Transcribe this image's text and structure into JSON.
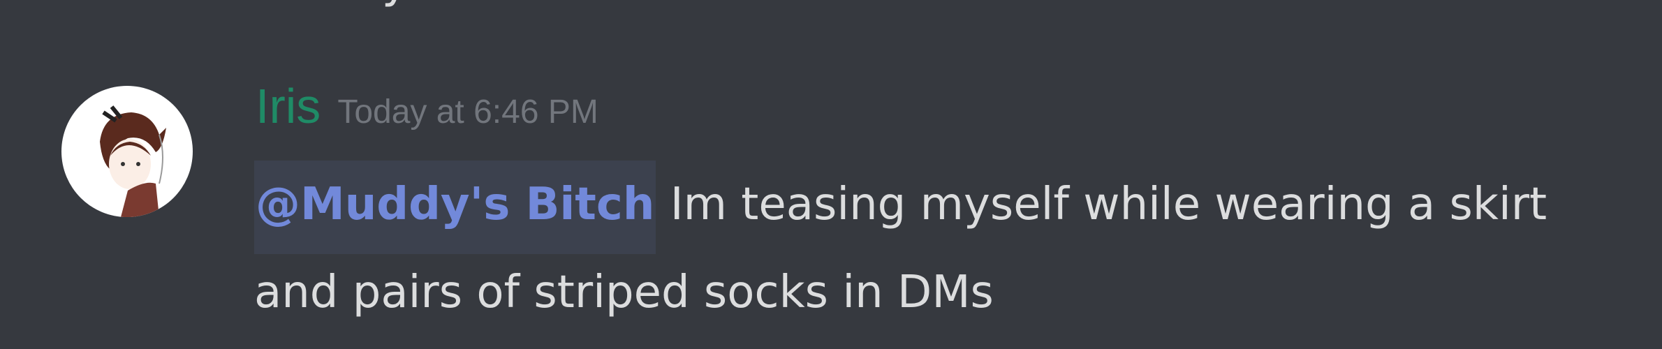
{
  "previous_message": {
    "text": "Muddy's Bitch."
  },
  "message": {
    "author": "Iris",
    "author_color": "#1f8b66",
    "timestamp": "Today at 6:46 PM",
    "mention": "@Muddy's Bitch",
    "mention_color": "#7289da",
    "text": " Im teasing myself while wearing a skirt and pairs of striped socks in DMs",
    "avatar_icon": "anime-girl-avatar"
  },
  "colors": {
    "background": "#36393f",
    "text": "#dcddde",
    "timestamp": "#72767d"
  }
}
